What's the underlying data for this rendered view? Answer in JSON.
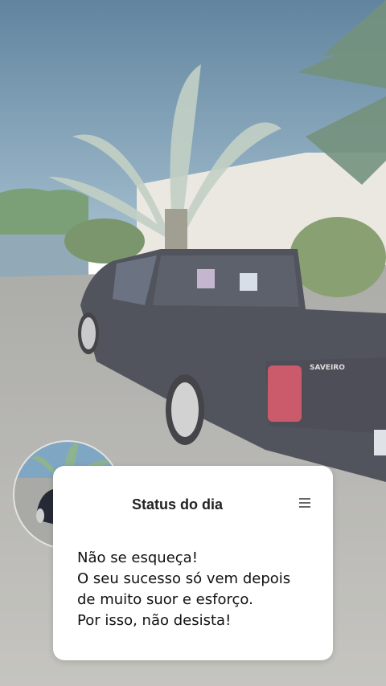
{
  "status_card": {
    "title": "Status do dia",
    "menu_icon": "hamburger-menu-icon",
    "message_lines": [
      "Não se esqueça!",
      "O seu sucesso só vem depois",
      "de muito suor e esforço.",
      "Por isso, não desista!"
    ]
  },
  "background_photo": {
    "tailgate_text": "SAVEIRO"
  }
}
